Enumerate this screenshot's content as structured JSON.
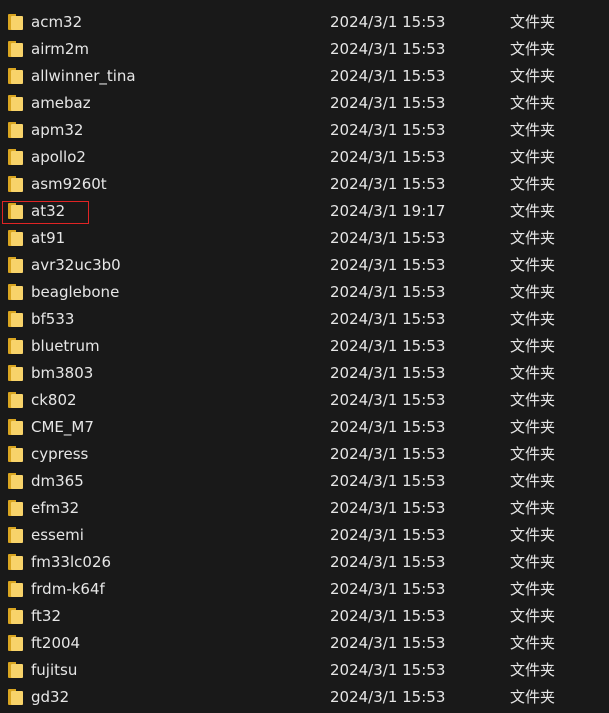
{
  "colors": {
    "background": "#191919",
    "text": "#e6e6e6",
    "folder_front": "#f8d36a",
    "folder_back": "#d9a520",
    "highlight": "#e02424"
  },
  "highlighted_row": "at32",
  "rows": [
    {
      "name": "acm32",
      "date": "2024/3/1 15:53",
      "type": "文件夹",
      "icon": "folder-icon"
    },
    {
      "name": "airm2m",
      "date": "2024/3/1 15:53",
      "type": "文件夹",
      "icon": "folder-icon"
    },
    {
      "name": "allwinner_tina",
      "date": "2024/3/1 15:53",
      "type": "文件夹",
      "icon": "folder-icon"
    },
    {
      "name": "amebaz",
      "date": "2024/3/1 15:53",
      "type": "文件夹",
      "icon": "folder-icon"
    },
    {
      "name": "apm32",
      "date": "2024/3/1 15:53",
      "type": "文件夹",
      "icon": "folder-icon"
    },
    {
      "name": "apollo2",
      "date": "2024/3/1 15:53",
      "type": "文件夹",
      "icon": "folder-icon"
    },
    {
      "name": "asm9260t",
      "date": "2024/3/1 15:53",
      "type": "文件夹",
      "icon": "folder-icon"
    },
    {
      "name": "at32",
      "date": "2024/3/1 19:17",
      "type": "文件夹",
      "icon": "folder-icon"
    },
    {
      "name": "at91",
      "date": "2024/3/1 15:53",
      "type": "文件夹",
      "icon": "folder-icon"
    },
    {
      "name": "avr32uc3b0",
      "date": "2024/3/1 15:53",
      "type": "文件夹",
      "icon": "folder-icon"
    },
    {
      "name": "beaglebone",
      "date": "2024/3/1 15:53",
      "type": "文件夹",
      "icon": "folder-icon"
    },
    {
      "name": "bf533",
      "date": "2024/3/1 15:53",
      "type": "文件夹",
      "icon": "folder-icon"
    },
    {
      "name": "bluetrum",
      "date": "2024/3/1 15:53",
      "type": "文件夹",
      "icon": "folder-icon"
    },
    {
      "name": "bm3803",
      "date": "2024/3/1 15:53",
      "type": "文件夹",
      "icon": "folder-icon"
    },
    {
      "name": "ck802",
      "date": "2024/3/1 15:53",
      "type": "文件夹",
      "icon": "folder-icon"
    },
    {
      "name": "CME_M7",
      "date": "2024/3/1 15:53",
      "type": "文件夹",
      "icon": "folder-icon"
    },
    {
      "name": "cypress",
      "date": "2024/3/1 15:53",
      "type": "文件夹",
      "icon": "folder-icon"
    },
    {
      "name": "dm365",
      "date": "2024/3/1 15:53",
      "type": "文件夹",
      "icon": "folder-icon"
    },
    {
      "name": "efm32",
      "date": "2024/3/1 15:53",
      "type": "文件夹",
      "icon": "folder-icon"
    },
    {
      "name": "essemi",
      "date": "2024/3/1 15:53",
      "type": "文件夹",
      "icon": "folder-icon"
    },
    {
      "name": "fm33lc026",
      "date": "2024/3/1 15:53",
      "type": "文件夹",
      "icon": "folder-icon"
    },
    {
      "name": "frdm-k64f",
      "date": "2024/3/1 15:53",
      "type": "文件夹",
      "icon": "folder-icon"
    },
    {
      "name": "ft32",
      "date": "2024/3/1 15:53",
      "type": "文件夹",
      "icon": "folder-icon"
    },
    {
      "name": "ft2004",
      "date": "2024/3/1 15:53",
      "type": "文件夹",
      "icon": "folder-icon"
    },
    {
      "name": "fujitsu",
      "date": "2024/3/1 15:53",
      "type": "文件夹",
      "icon": "folder-icon"
    },
    {
      "name": "gd32",
      "date": "2024/3/1 15:53",
      "type": "文件夹",
      "icon": "folder-icon"
    }
  ]
}
